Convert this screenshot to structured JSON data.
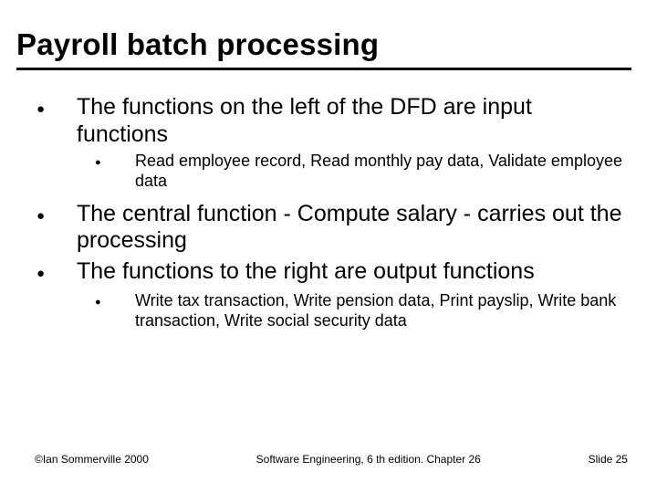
{
  "title": "Payroll batch processing",
  "bullets": [
    {
      "text": "The functions on the left of the DFD are input functions",
      "sub": [
        "Read employee record, Read monthly pay data, Validate employee data"
      ]
    },
    {
      "text": "The central function - Compute salary - carries out the processing",
      "sub": []
    },
    {
      "text": "The functions to the right are output functions",
      "sub": [
        "Write tax transaction, Write pension data, Print payslip, Write bank transaction, Write social security data"
      ]
    }
  ],
  "footer": {
    "left": "©Ian Sommerville 2000",
    "center": "Software Engineering, 6 th edition. Chapter 26",
    "right": "Slide 25"
  }
}
